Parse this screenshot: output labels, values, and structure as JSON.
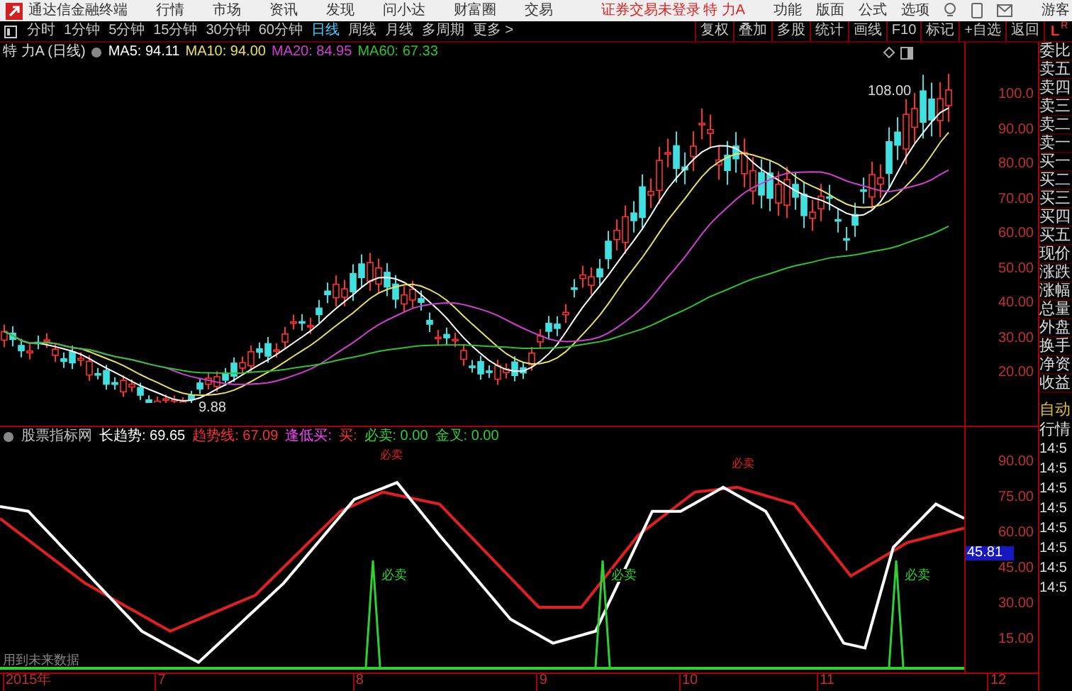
{
  "app": {
    "title": "通达信金融终端",
    "menu": [
      "行情",
      "市场",
      "资讯",
      "发现",
      "问小达",
      "财富圈",
      "交易"
    ],
    "login_status": "证券交易未登录",
    "stock_name": "特 力A",
    "right_menu": [
      "功能",
      "版面",
      "公式",
      "选项"
    ],
    "user": "游客"
  },
  "periods": [
    {
      "label": "分时",
      "selected": false
    },
    {
      "label": "1分钟",
      "selected": false
    },
    {
      "label": "5分钟",
      "selected": false
    },
    {
      "label": "15分钟",
      "selected": false
    },
    {
      "label": "30分钟",
      "selected": false
    },
    {
      "label": "60分钟",
      "selected": false
    },
    {
      "label": "日线",
      "selected": true
    },
    {
      "label": "周线",
      "selected": false
    },
    {
      "label": "月线",
      "selected": false
    },
    {
      "label": "多周期",
      "selected": false
    },
    {
      "label": "更多 >",
      "selected": false
    }
  ],
  "tools": [
    "复权",
    "叠加",
    "多股",
    "统计",
    "画线",
    "F10",
    "标记",
    "+自选",
    "返回"
  ],
  "layout_switch": [
    "L",
    "R"
  ],
  "chart": {
    "title": "特 力A (日线)",
    "ma": [
      {
        "label": "MA5: 94.11",
        "color": "#ffffff"
      },
      {
        "label": "MA10: 94.00",
        "color": "#e8e060"
      },
      {
        "label": "MA20: 84.95",
        "color": "#d040d0"
      },
      {
        "label": "MA60: 67.33",
        "color": "#30c030"
      }
    ],
    "high_label": "108.00",
    "low_label": "9.88",
    "axis": [
      "100.0",
      "90.00",
      "80.00",
      "70.00",
      "60.00",
      "50.00",
      "40.00",
      "30.00",
      "20.00"
    ]
  },
  "indicator": {
    "legend": [
      {
        "text": "股票指标网",
        "color": "#c0c0c0"
      },
      {
        "text": "长趋势: 69.65",
        "color": "#ffffff"
      },
      {
        "text": "趋势线: 67.09",
        "color": "#ff3030"
      },
      {
        "text": "逢低买:",
        "color": "#ff40ff"
      },
      {
        "text": "买:",
        "color": "#ff3030"
      },
      {
        "text": "必卖: 0.00",
        "color": "#30d030"
      },
      {
        "text": "金叉: 0.00",
        "color": "#30d030"
      }
    ],
    "axis": [
      "90.00",
      "75.00",
      "60.00",
      "45.00",
      "30.00",
      "15.00"
    ],
    "current": "45.81",
    "signals": [
      "必卖",
      "必卖",
      "必卖"
    ],
    "peak_labels": [
      "必卖",
      "必卖"
    ],
    "note": "用到未来数据"
  },
  "dates": [
    "2015年",
    "7",
    "8",
    "9",
    "10",
    "11",
    "12"
  ],
  "quote_fields": [
    "委比",
    "卖五",
    "卖四",
    "卖三",
    "卖二",
    "卖一",
    "买一",
    "买二",
    "买三",
    "买四",
    "买五",
    "现价",
    "涨跌",
    "涨幅",
    "总量",
    "外盘",
    "换手",
    "净资",
    "收益"
  ],
  "quote_lower": [
    "自动",
    "行情"
  ],
  "ticks": [
    "14:5",
    "14:5",
    "14:5",
    "14:5",
    "14:5",
    "14:5",
    "14:5",
    "14:5"
  ]
}
